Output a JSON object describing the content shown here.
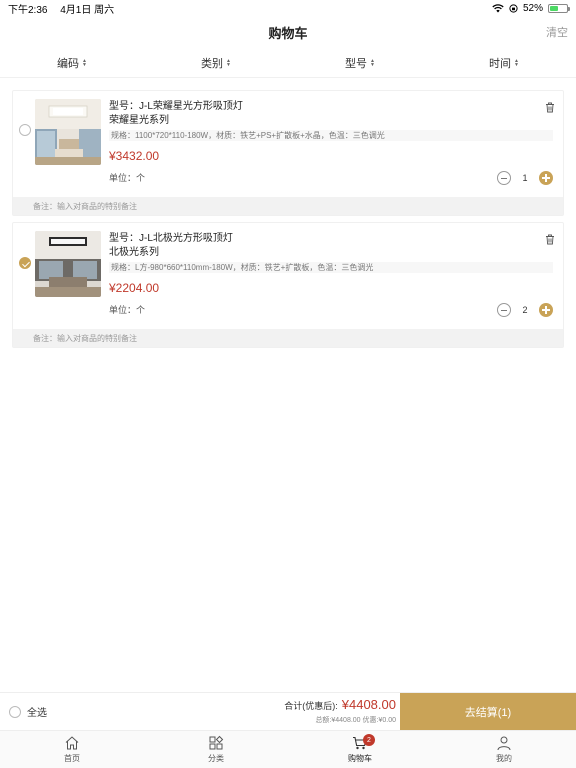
{
  "status_bar": {
    "time": "下午2:36",
    "date": "4月1日 周六",
    "battery": "52%"
  },
  "header": {
    "title": "购物车",
    "clear_label": "清空"
  },
  "sort_bar": [
    {
      "label": "编码"
    },
    {
      "label": "类别"
    },
    {
      "label": "型号"
    },
    {
      "label": "时间"
    }
  ],
  "items": [
    {
      "model": "型号：J-L荣耀星光方形吸顶灯",
      "series": "荣耀星光系列",
      "spec": "规格：1100*720*110-180W，材质：铁艺+PS+扩散板+水晶，色温：三色调光",
      "price": "¥3432.00",
      "unit": "单位：个",
      "quantity": "1",
      "checked": false,
      "remark_placeholder": "备注：输入对商品的特别备注"
    },
    {
      "model": "型号：J-L北极光方形吸顶灯",
      "series": "北极光系列",
      "spec": "规格：L方-980*660*110mm-180W，材质：铁艺+扩散板，色温：三色调光",
      "price": "¥2204.00",
      "unit": "单位：个",
      "quantity": "2",
      "checked": true,
      "remark_placeholder": "备注：输入对商品的特别备注"
    }
  ],
  "checkout": {
    "select_all_label": "全选",
    "total_label": "合计(优惠后):",
    "total_amount": "¥4408.00",
    "breakdown": "总额:¥4408.00 优惠:¥0.00",
    "button_label": "去结算(1)"
  },
  "tabbar": [
    {
      "label": "首页",
      "icon": "home-icon"
    },
    {
      "label": "分类",
      "icon": "category-icon"
    },
    {
      "label": "购物车",
      "icon": "cart-icon",
      "badge": "2",
      "active": true
    },
    {
      "label": "我的",
      "icon": "profile-icon"
    }
  ],
  "colors": {
    "accent": "#c9a357",
    "price": "#c0392b"
  }
}
